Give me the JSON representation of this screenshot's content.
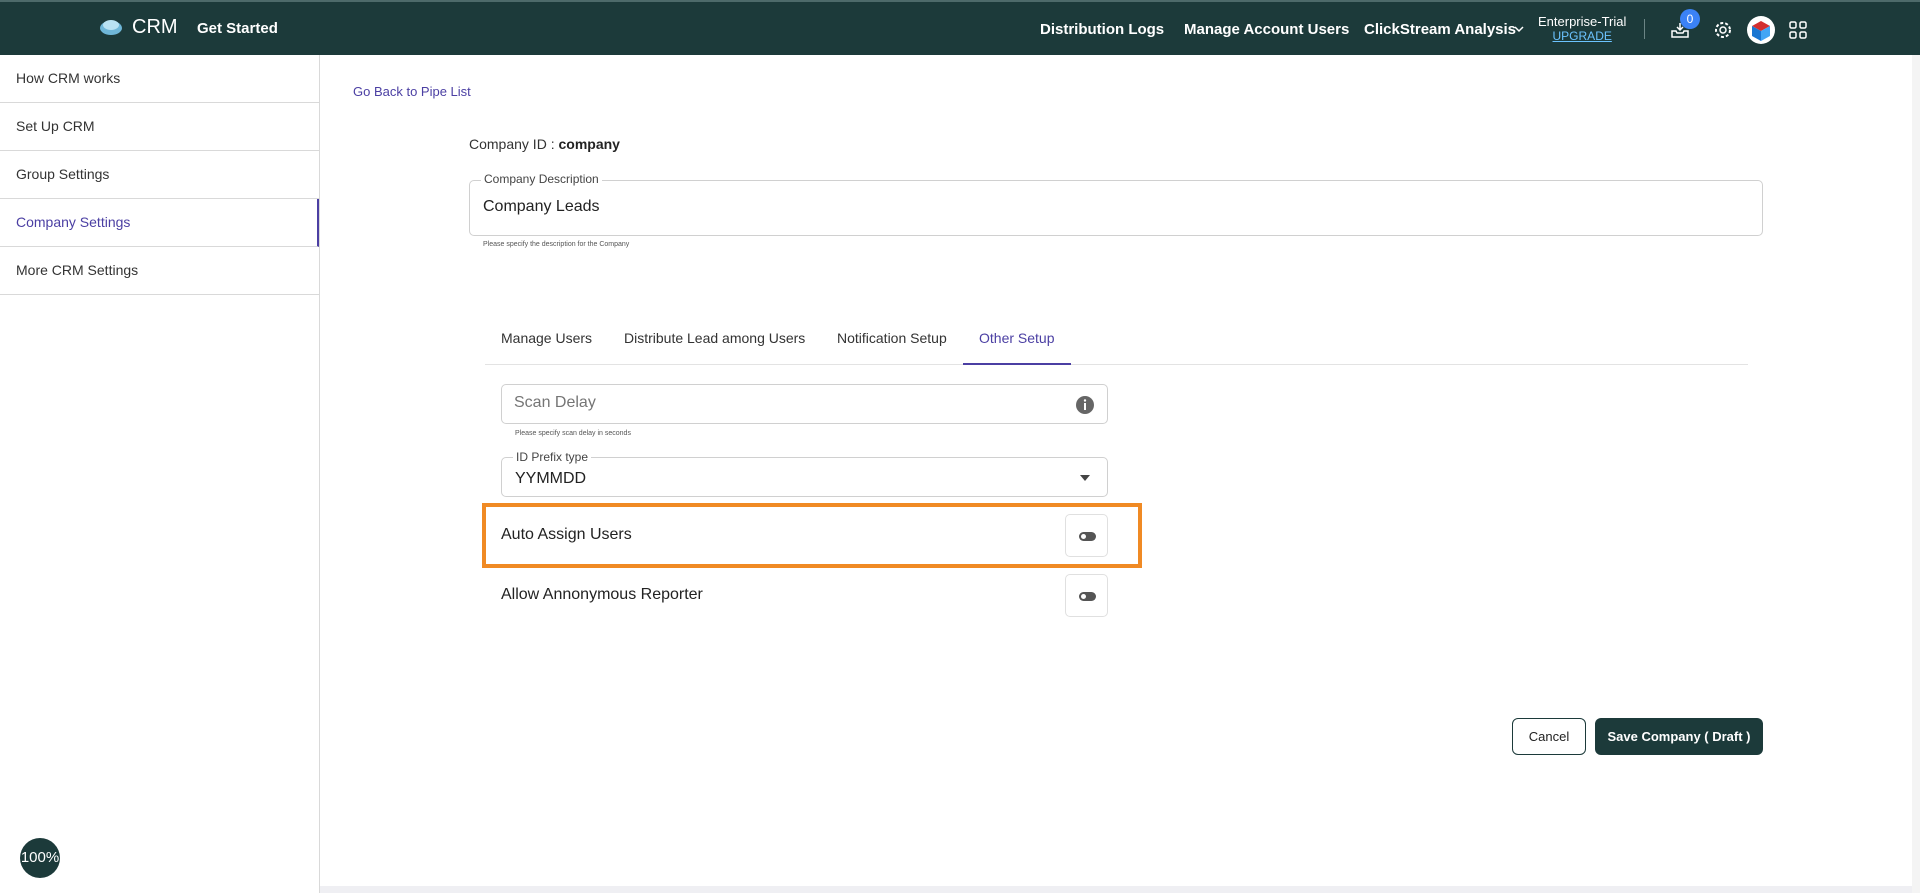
{
  "header": {
    "app_name": "CRM",
    "get_started": "Get Started",
    "nav": {
      "distribution_logs": "Distribution Logs",
      "manage_account_users": "Manage Account Users",
      "clickstream_analysis": "ClickStream Analysis"
    },
    "plan": "Enterprise-Trial",
    "upgrade": "UPGRADE",
    "notification_count": "0"
  },
  "sidebar": {
    "items": [
      {
        "label": "How CRM works"
      },
      {
        "label": "Set Up CRM"
      },
      {
        "label": "Group Settings"
      },
      {
        "label": "Company Settings"
      },
      {
        "label": "More CRM Settings"
      }
    ]
  },
  "main": {
    "back_link": "Go Back to Pipe List",
    "company_id_label": "Company ID :",
    "company_id_value": "company",
    "description": {
      "label": "Company Description",
      "value": "Company Leads",
      "help": "Please specify the description for the Company"
    },
    "tabs": [
      {
        "label": "Manage Users"
      },
      {
        "label": "Distribute Lead among Users"
      },
      {
        "label": "Notification Setup"
      },
      {
        "label": "Other Setup"
      }
    ],
    "scan_delay": {
      "placeholder": "Scan Delay",
      "help": "Please specify scan delay in seconds"
    },
    "id_prefix": {
      "label": "ID Prefix type",
      "value": "YYMMDD"
    },
    "toggles": {
      "auto_assign": "Auto Assign Users",
      "anonymous_reporter": "Allow Annonymous Reporter"
    },
    "buttons": {
      "cancel": "Cancel",
      "save": "Save Company ( Draft )"
    }
  },
  "zoom": "100%",
  "colors": {
    "header_bg": "#1c3a3a",
    "accent": "#4b3fa3",
    "highlight": "#f08a24",
    "badge": "#3b82f6"
  }
}
